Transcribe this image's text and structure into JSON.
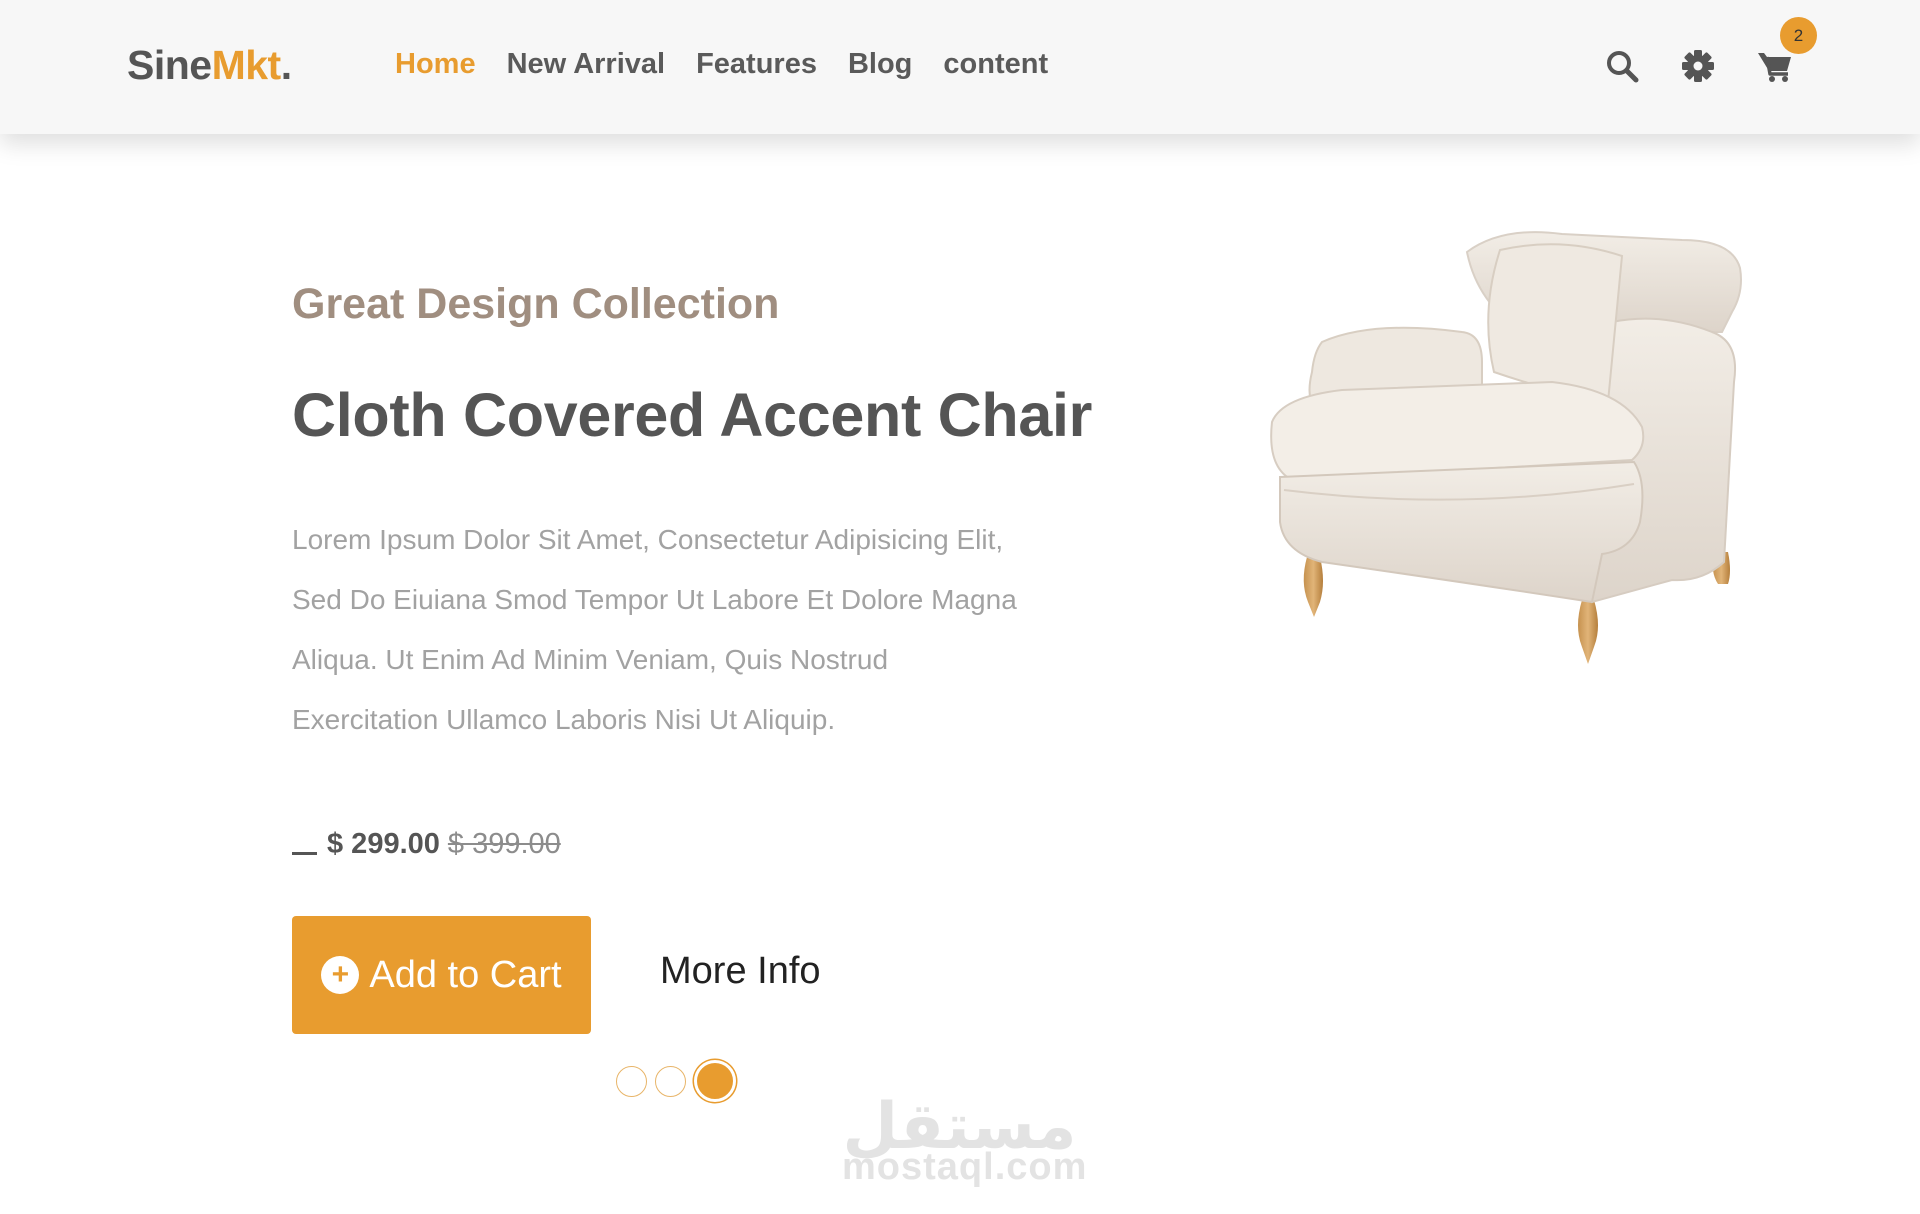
{
  "header": {
    "logo_main": "Sine",
    "logo_accent": "Mkt",
    "logo_dot": ".",
    "nav": [
      {
        "label": "Home",
        "active": true
      },
      {
        "label": "New Arrival",
        "active": false
      },
      {
        "label": "Features",
        "active": false
      },
      {
        "label": "Blog",
        "active": false
      },
      {
        "label": "content",
        "active": false
      }
    ],
    "icons": [
      "search-icon",
      "gear-icon",
      "cart-icon"
    ],
    "cart_count": "2"
  },
  "hero": {
    "subtitle": "Great Design Collection",
    "title": "Cloth Covered Accent Chair",
    "description_lines": [
      "Lorem Ipsum Dolor Sit Amet, Consectetur Adipisicing Elit,",
      "Sed Do Eiuiana Smod Tempor Ut Labore Et Dolore Magna",
      "Aliqua. Ut Enim Ad Minim Veniam, Quis Nostrud",
      "Exercitation Ullamco Laboris Nisi Ut Aliquip."
    ],
    "price": "$ 299.00",
    "old_price": "$ 399.00",
    "add_to_cart": "Add to Cart",
    "more_info": "More Info",
    "product_image": "accent-chair-image"
  },
  "carousel": {
    "slides": 3,
    "active_index": 2
  },
  "watermark": {
    "arabic": "مستقل",
    "latin": "mostaql.com"
  },
  "colors": {
    "accent": "#e89c2f",
    "text_dark": "#555555",
    "text_muted": "#a2a2a2",
    "subtitle": "#a08e80",
    "header_bg": "#f7f7f7"
  }
}
